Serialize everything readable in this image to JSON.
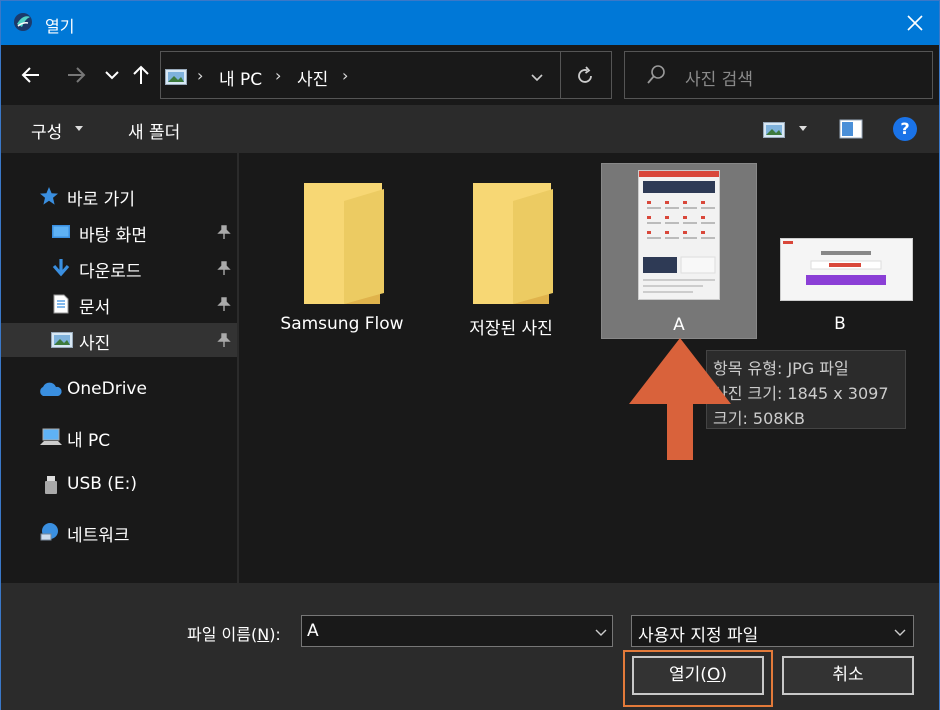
{
  "window": {
    "title": "열기",
    "accent_color": "#0078d7"
  },
  "nav": {
    "back_icon": "back-arrow-icon",
    "forward_icon": "forward-arrow-icon",
    "recent_icon": "chevron-down-icon",
    "up_icon": "up-arrow-icon",
    "breadcrumb": [
      "내 PC",
      "사진"
    ],
    "search_placeholder": "사진 검색"
  },
  "toolbar": {
    "organize_label": "구성",
    "new_folder_label": "새 폴더",
    "help_label": "?"
  },
  "sidebar": {
    "items": [
      {
        "label": "바로 가기",
        "icon": "star-icon",
        "pinned": false
      },
      {
        "label": "바탕 화면",
        "icon": "desktop-icon",
        "pinned": true
      },
      {
        "label": "다운로드",
        "icon": "download-icon",
        "pinned": true
      },
      {
        "label": "문서",
        "icon": "document-icon",
        "pinned": true
      },
      {
        "label": "사진",
        "icon": "pictures-icon",
        "pinned": true,
        "selected": true
      },
      {
        "label": "OneDrive",
        "icon": "cloud-icon",
        "pinned": false
      },
      {
        "label": "내 PC",
        "icon": "computer-icon",
        "pinned": false
      },
      {
        "label": "USB (E:)",
        "icon": "usb-drive-icon",
        "pinned": false
      },
      {
        "label": "네트워크",
        "icon": "network-icon",
        "pinned": false
      }
    ]
  },
  "content": {
    "items": [
      {
        "name": "Samsung Flow",
        "type": "folder"
      },
      {
        "name": "저장된 사진",
        "type": "folder"
      },
      {
        "name": "A",
        "type": "image",
        "selected": true
      },
      {
        "name": "B",
        "type": "image"
      }
    ],
    "tooltip": {
      "type_line": "항목 유형: JPG 파일",
      "size_line": "사진 크기: 1845 x 3097",
      "bytes_line": "크기: 508KB"
    },
    "annotation_arrow_color": "#d9623b"
  },
  "bottom": {
    "filename_label_prefix": "파일 이름(",
    "filename_label_key": "N",
    "filename_label_suffix": "):",
    "filename_value": "A",
    "filetype_value": "사용자 지정 파일",
    "open_label_prefix": "열기(",
    "open_label_key": "O",
    "open_label_suffix": ")",
    "cancel_label": "취소",
    "highlight_color": "#e37a3a"
  }
}
